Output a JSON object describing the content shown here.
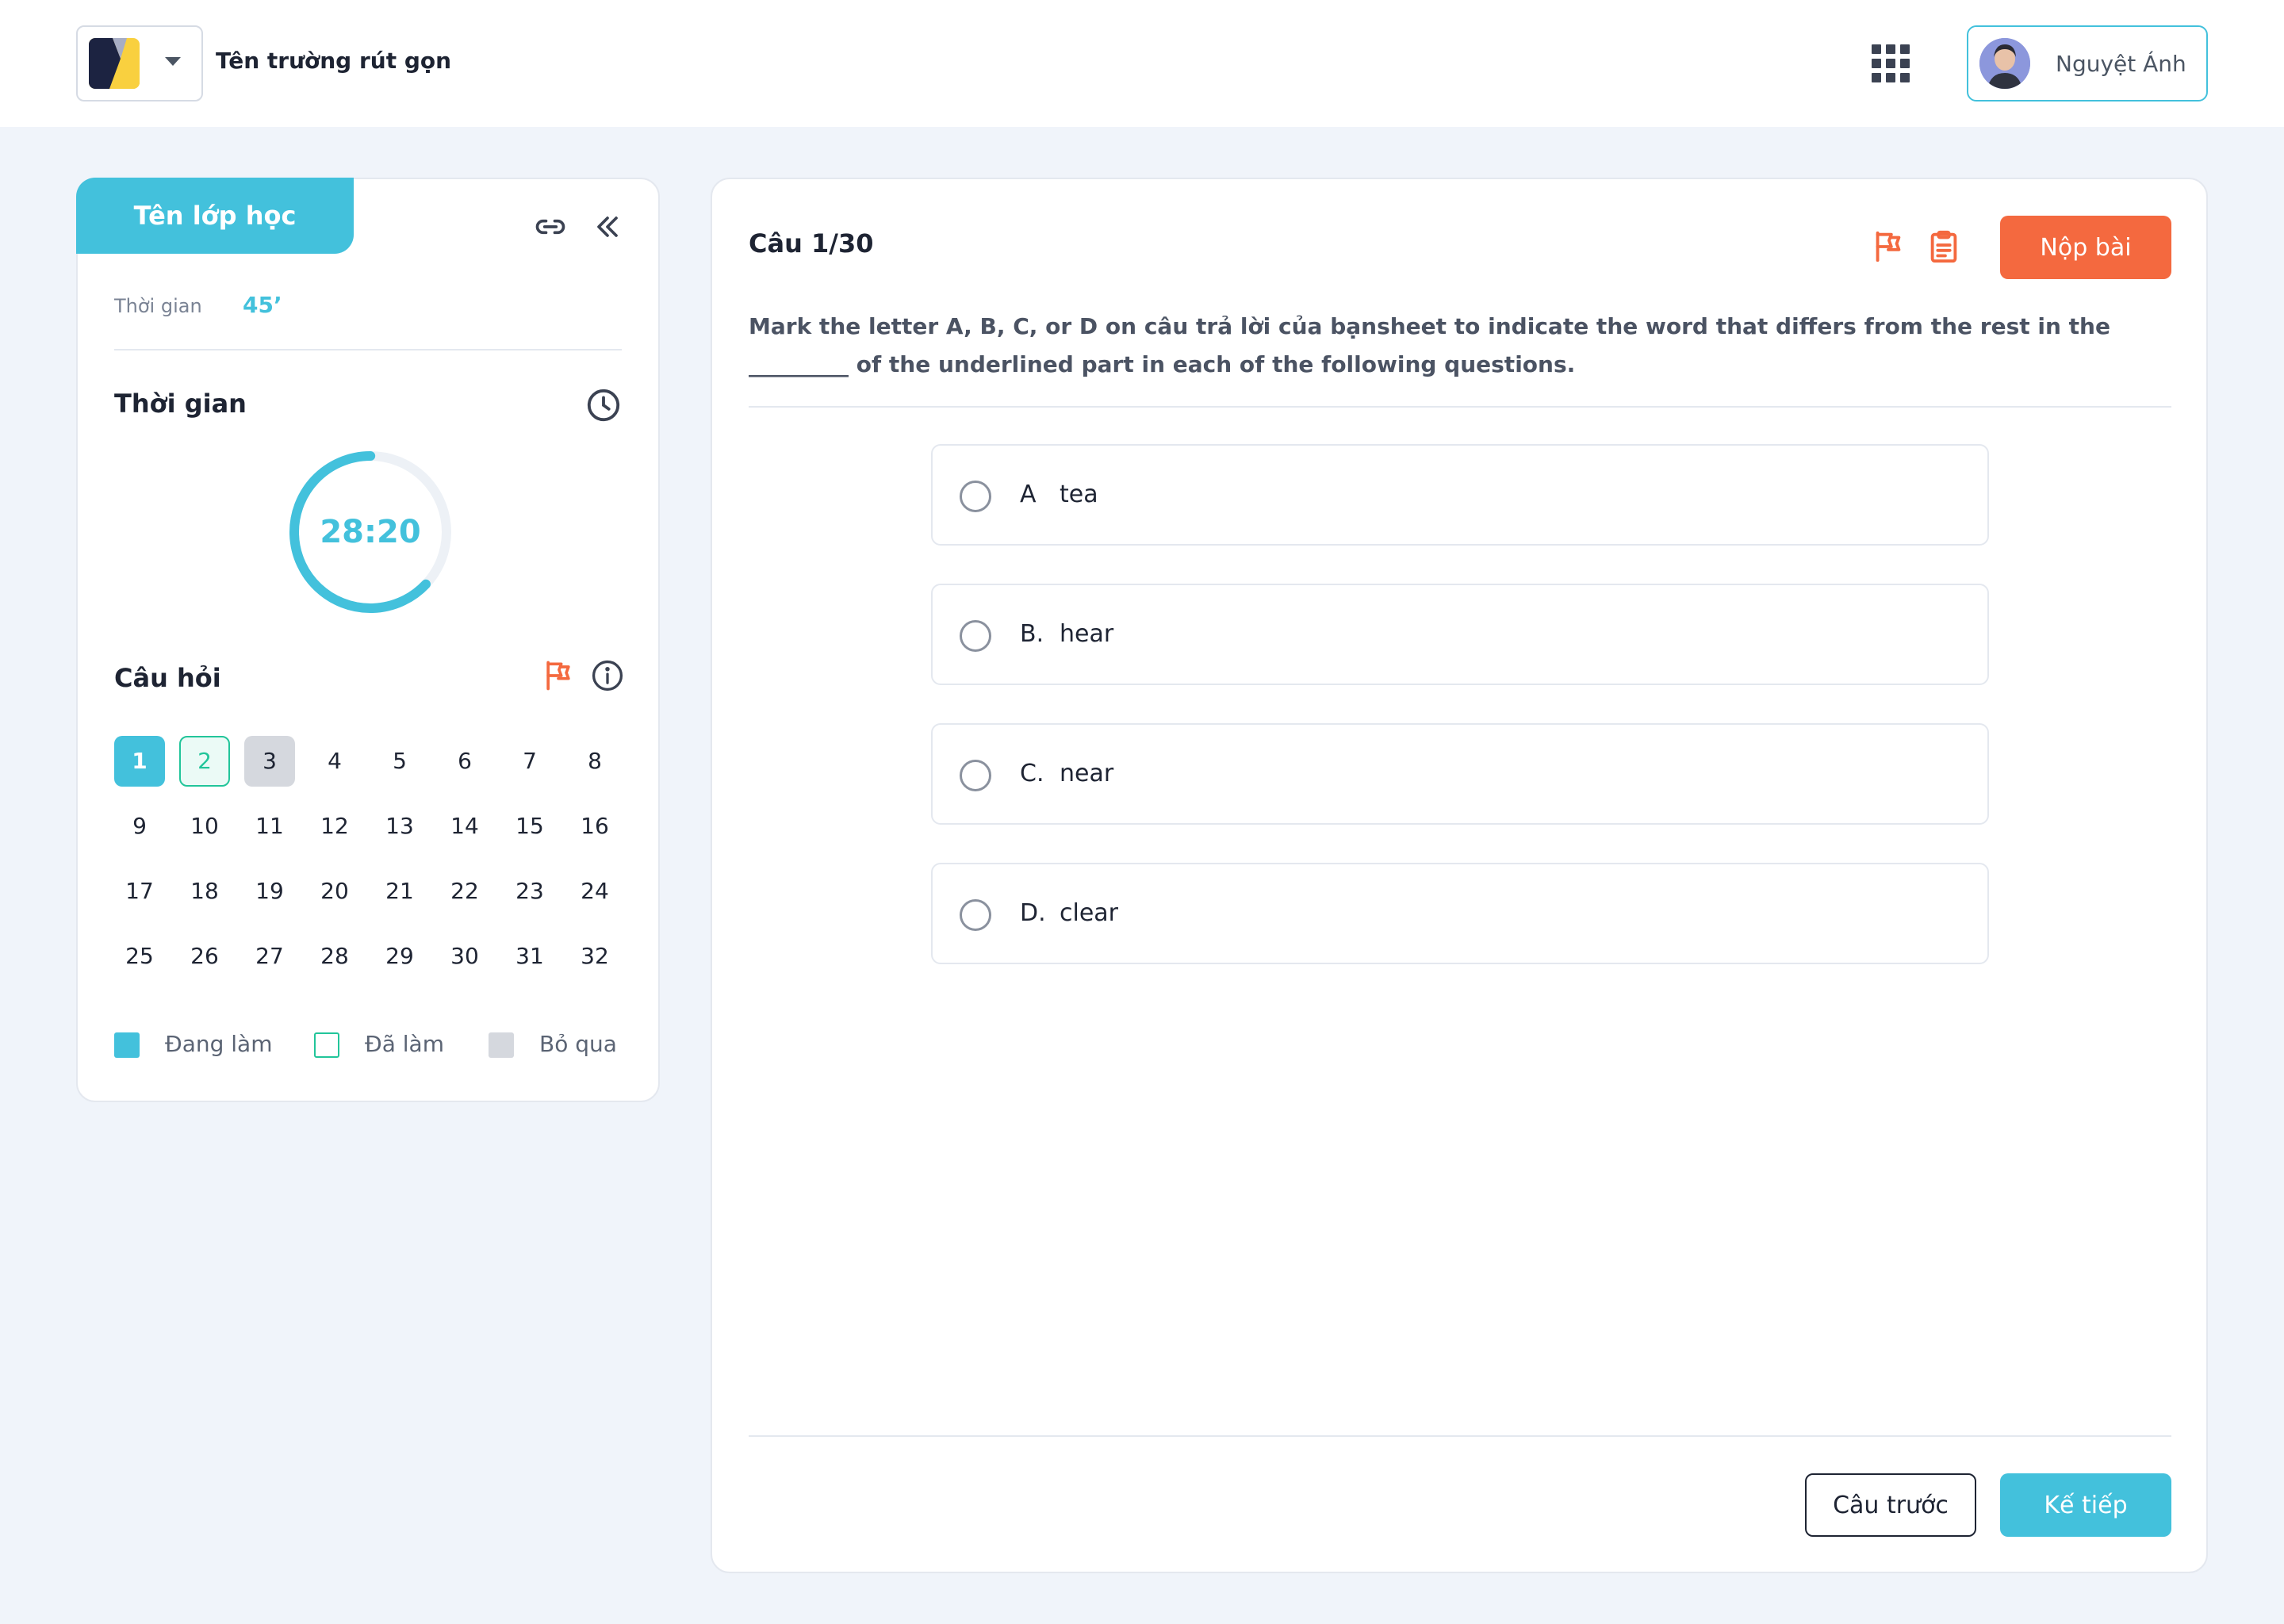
{
  "header": {
    "school_name": "Tên trường rút gọn",
    "user_name": "Nguyệt Ánh",
    "apps_icon": "apps-grid-icon",
    "caret_icon": "caret-down-icon"
  },
  "sidebar": {
    "class_name": "Tên lớp học",
    "duration_label": "Thời gian",
    "duration_value": "45’",
    "timer_title": "Thời gian",
    "timer_value": "28:20",
    "timer_progress": 0.63,
    "questions_title": "Câu hỏi",
    "question_numbers": [
      "1",
      "2",
      "3",
      "4",
      "5",
      "6",
      "7",
      "8",
      "9",
      "10",
      "11",
      "12",
      "13",
      "14",
      "15",
      "16",
      "17",
      "18",
      "19",
      "20",
      "21",
      "22",
      "23",
      "24",
      "25",
      "26",
      "27",
      "28",
      "29",
      "30",
      "31",
      "32"
    ],
    "question_states": {
      "1": "current",
      "2": "done",
      "3": "skipped"
    },
    "legend": [
      {
        "label": "Đang làm",
        "color": "#43c1dc",
        "style": "filled"
      },
      {
        "label": "Đã làm",
        "color": "#22c59a",
        "style": "outline"
      },
      {
        "label": "Bỏ qua",
        "color": "#d5d8de",
        "style": "filled"
      }
    ]
  },
  "main": {
    "counter": "Câu 1/30",
    "submit_label": "Nộp bài",
    "question": "Mark the letter A, B, C, or D on câu trả lời của bạnsheet to indicate the word that differs from the rest in the _________ of the underlined part in each of the following questions.",
    "options": [
      {
        "letter": "A",
        "text": "tea"
      },
      {
        "letter": "B.",
        "text": "hear"
      },
      {
        "letter": "C.",
        "text": "near"
      },
      {
        "letter": "D.",
        "text": "clear"
      }
    ],
    "prev_label": "Câu trước",
    "next_label": "Kế tiếp"
  },
  "colors": {
    "accent": "#43c1dc",
    "submit": "#f4693f",
    "done": "#22c59a",
    "skipped": "#d5d8de",
    "page_bg": "#f0f4fa"
  }
}
